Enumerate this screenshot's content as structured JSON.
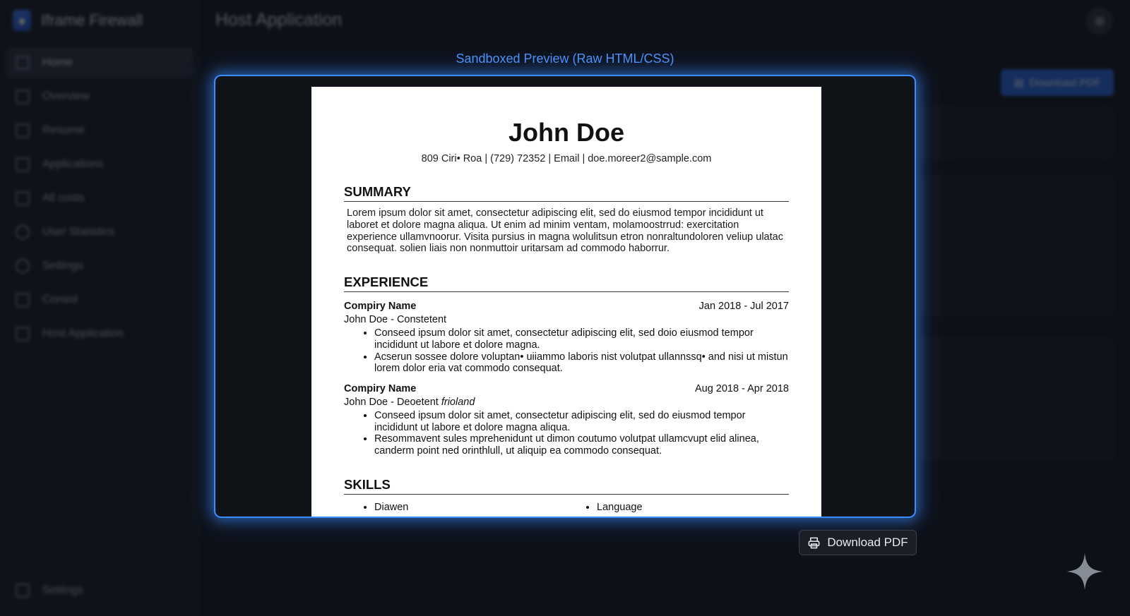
{
  "app": {
    "brand_name": "Iframe Firewall",
    "page_title": "Host Application"
  },
  "sidebar": {
    "items": [
      {
        "label": "Home",
        "icon": "home-icon",
        "active": true
      },
      {
        "label": "Overview",
        "icon": "chart-icon"
      },
      {
        "label": "Resume",
        "icon": "calendar-icon"
      },
      {
        "label": "Applications",
        "icon": "document-icon"
      },
      {
        "label": "All costs",
        "icon": "users-icon"
      },
      {
        "label": "User Statistics",
        "icon": "user-stats-icon"
      },
      {
        "label": "Settings",
        "icon": "gear-icon"
      },
      {
        "label": "Consol",
        "icon": "folder-icon"
      },
      {
        "label": "Host Application",
        "icon": "exit-icon"
      }
    ],
    "bottom_label": "Settings"
  },
  "background": {
    "download_label": "Download PDF"
  },
  "preview": {
    "caption": "Sandboxed Preview (Raw HTML/CSS)",
    "download_label": "Download PDF"
  },
  "resume": {
    "name": "John Doe",
    "contact": "809 Ciri• Roa | (729) 72352 | Email | doe.moreer2@sample.com",
    "summary_heading": "SUMMARY",
    "summary": "Lorem ipsum dolor sit amet, consectetur adipiscing elit, sed do eiusmod tempor incididunt ut laboret et dolore magna aliqua. Ut enim ad minim ventam, molamoostrrud: exercitation experience ullamvnoorur. Visita pursius in magna wolulitsun etron nonraltundoloren veliup ulatac consequat. solien liais non nonmuttoir uritarsam ad commodo haborrur.",
    "experience_heading": "EXPERIENCE",
    "jobs": [
      {
        "company": "Compiry Name",
        "dates": "Jan 2018 - Jul 2017",
        "role": "John Doe - Constetent",
        "role_italic": "",
        "bullets": [
          "Conseed ipsum dolor sit amet, consectetur adipiscing elit, sed doio eiusmod tempor incididunt ut labore et dolore magna.",
          "Acserun sossee dolore voluptan• uiiammo laboris nist volutpat ullannssq• and nisi ut mistun lorem dolor eria vat commodo consequat."
        ]
      },
      {
        "company": "Compiry Name",
        "dates": "Aug 2018 - Apr 2018",
        "role": "John Doe - Deoetent",
        "role_italic": "frioland",
        "bullets": [
          "Conseed ipsum dolor sit amet, consectetur adipiscing elit, sed do eiusmod tempor incididunt ut labore et dolore magna aliqua.",
          "Resommavent sules mprehenidunt ut dimon coutumo volutpat ullamcvupt elid alinea, canderm point ned orinthlull, ut aliquip ea commodo consequat."
        ]
      }
    ],
    "skills_heading": "SKILLS",
    "skills": [
      "Diawen",
      "Language"
    ]
  }
}
